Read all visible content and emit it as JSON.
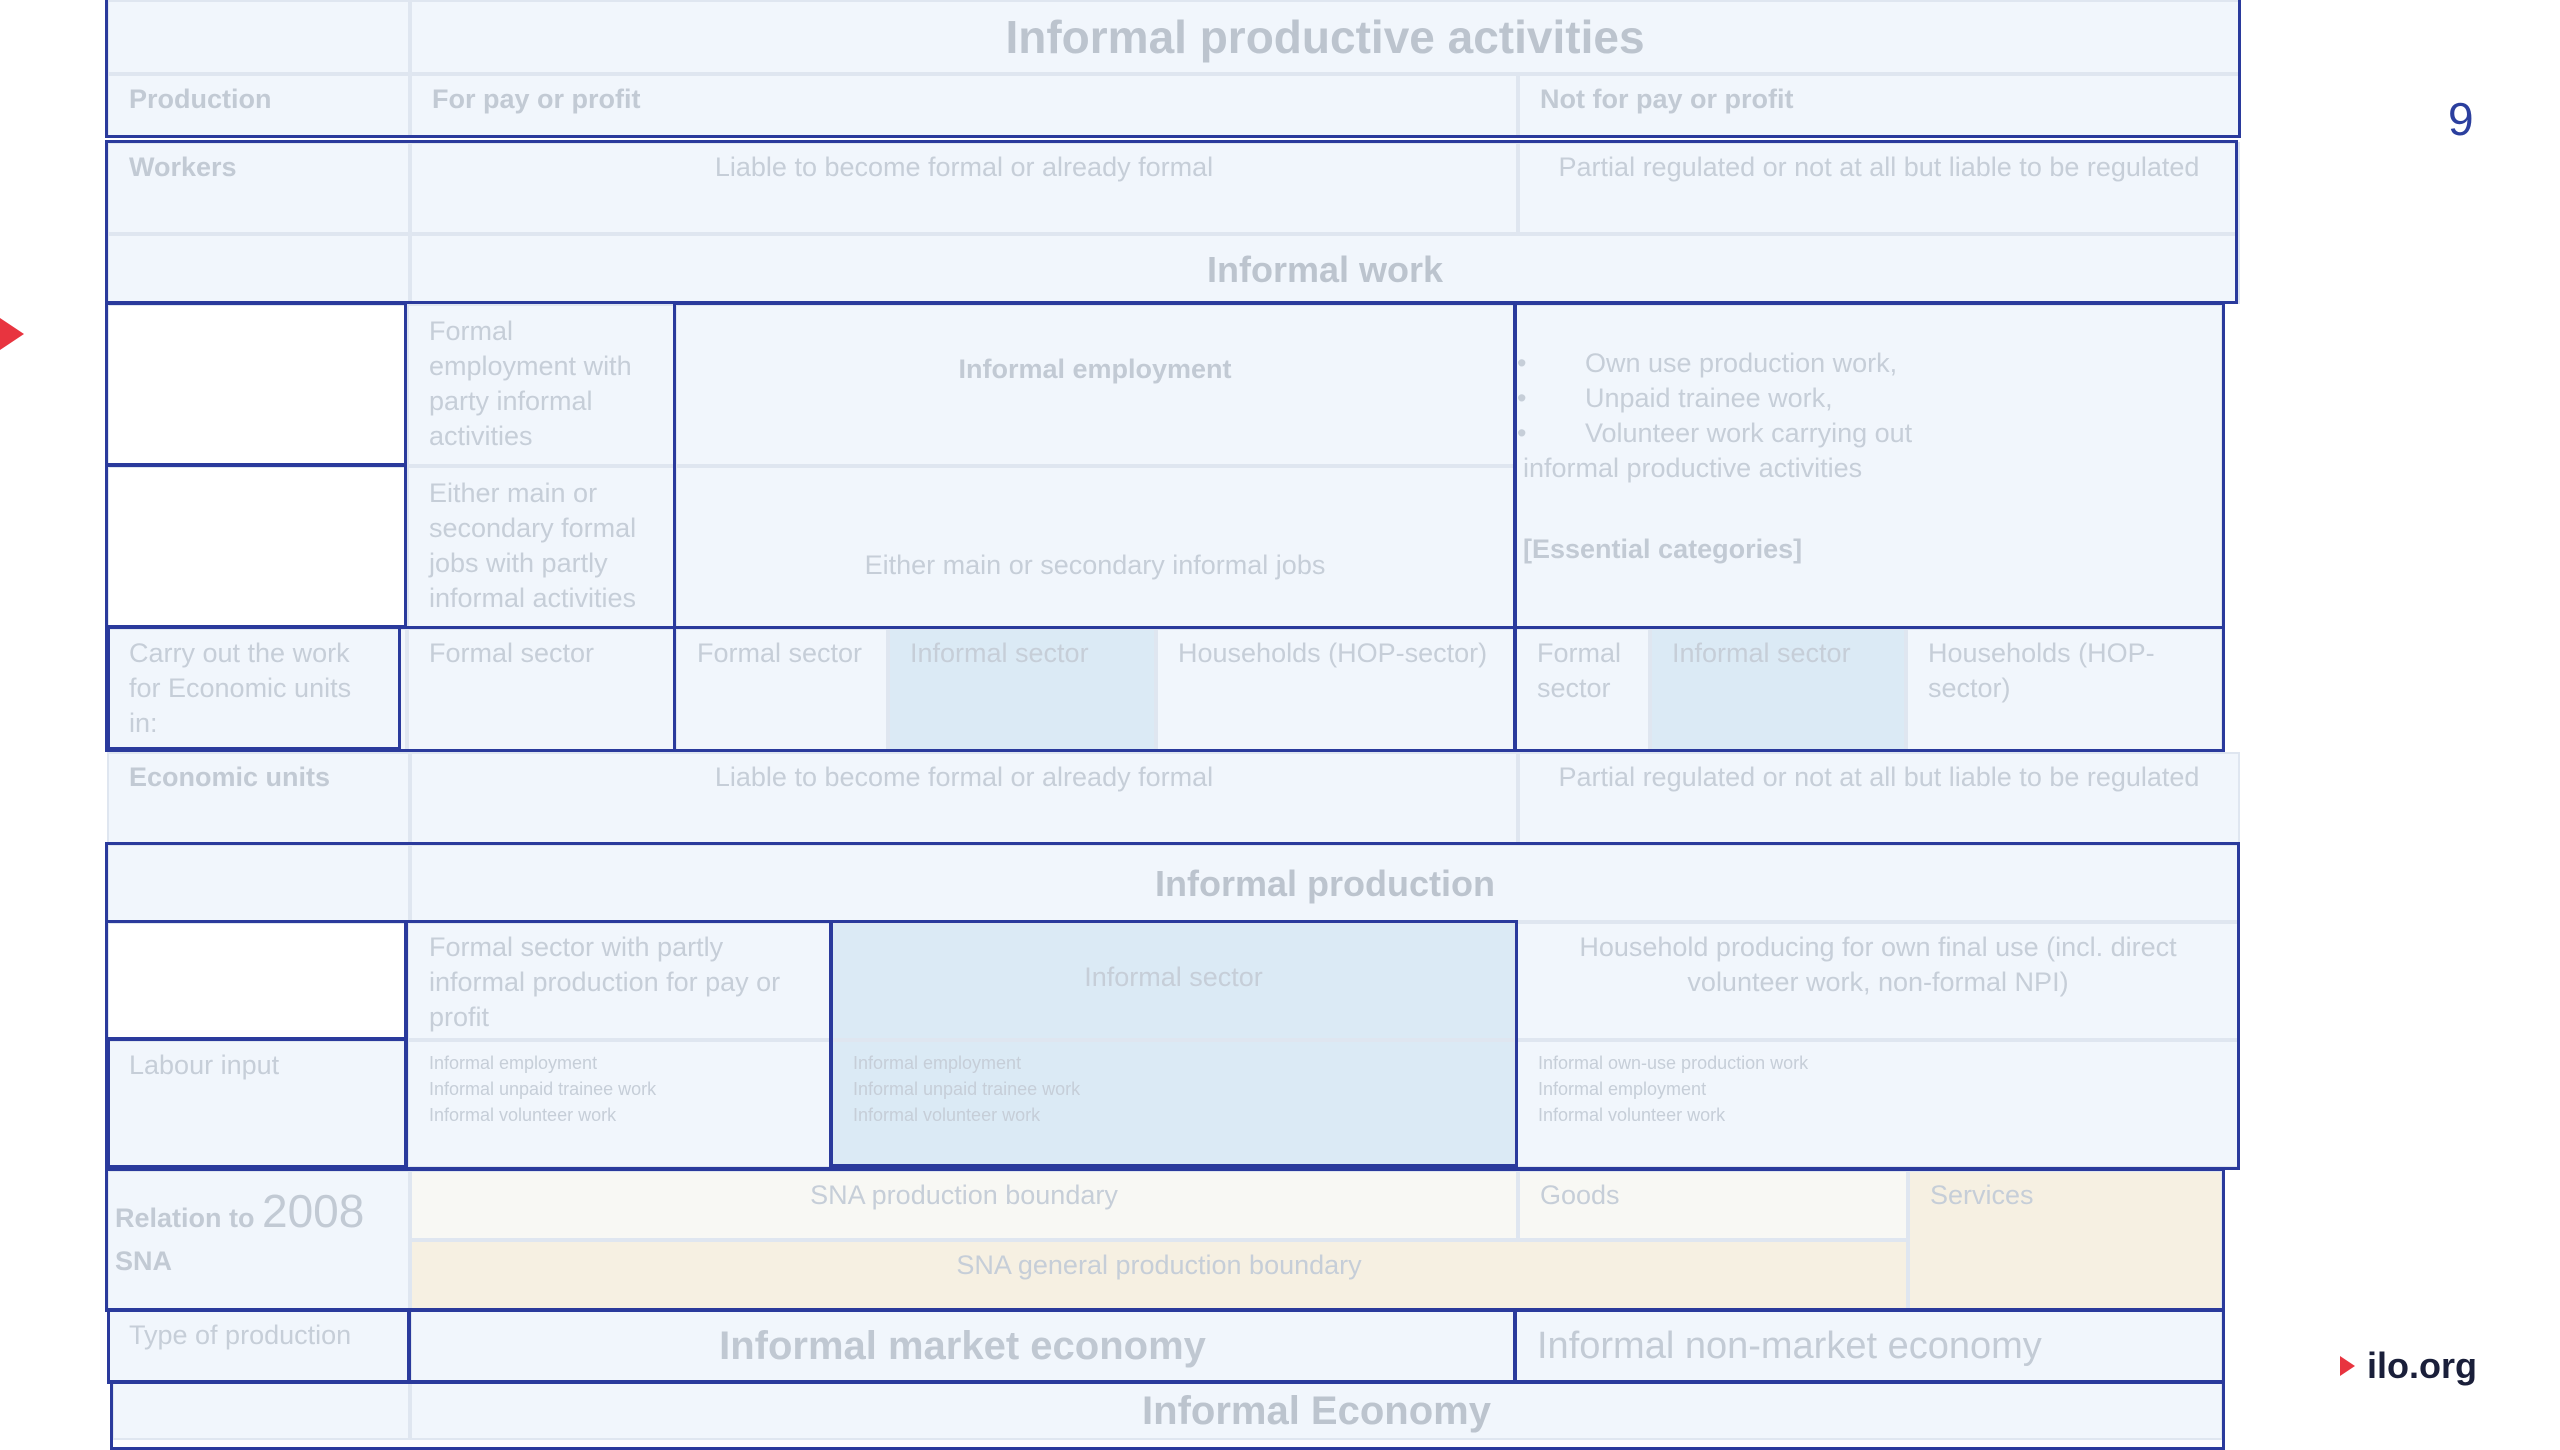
{
  "page_number": "9",
  "footer": {
    "brand": "ilo.org"
  },
  "title": "Informal productive activities",
  "header_row": {
    "label": "Production",
    "pay": "For pay or profit",
    "not_pay": "Not for pay or profit"
  },
  "workers_row": {
    "label": "Workers",
    "pay": "Liable to become formal or already formal",
    "not_pay": "Partial regulated or not at all but liable to be regulated"
  },
  "informal_work": "Informal work",
  "employment": {
    "formal_partly": "Formal employment with party informal activities",
    "formal_jobs": "Either main or secondary formal jobs with partly informal activities",
    "informal_employment": "Informal employment",
    "informal_jobs": "Either main or secondary informal jobs",
    "not_pay_items": [
      "Own use production work,",
      "Unpaid trainee work,",
      "Volunteer work carrying out"
    ],
    "not_pay_tail": "informal productive  activities",
    "essential": "[Essential categories]"
  },
  "units_row": {
    "label": "Carry out the work for Economic units in:",
    "formal_sector": "Formal sector",
    "formal_sector_2": "Formal sector",
    "informal_sector": "Informal sector",
    "households": "Households (HOP-sector)",
    "formal_sector_3": "Formal sector",
    "informal_sector_2": "Informal sector",
    "households_2": "Households (HOP-sector)"
  },
  "economic_units_row": {
    "label": "Economic units",
    "pay": "Liable to become formal or already formal",
    "not_pay": "Partial regulated or not at all but liable to be regulated"
  },
  "informal_production": "Informal production",
  "production": {
    "formal_partly": "Formal sector with partly informal production for pay or profit",
    "informal_sector": "Informal sector",
    "household": "Household producing for own final use (incl. direct volunteer work, non-formal NPI)"
  },
  "labour": {
    "label": "Labour input",
    "col1": [
      "Informal employment",
      "Informal unpaid trainee work",
      "Informal volunteer work"
    ],
    "col2": [
      "Informal employment",
      "Informal unpaid trainee work",
      "Informal volunteer work"
    ],
    "col3": [
      "Informal own-use production work",
      "Informal employment",
      "Informal volunteer work"
    ]
  },
  "sna": {
    "label_prefix": "Relation to ",
    "year": "2008",
    "label_suffix": "SNA",
    "production_boundary": "SNA production boundary",
    "goods": "Goods",
    "services": "Services",
    "general_boundary": "SNA general production boundary"
  },
  "type_row": {
    "label": "Type of production",
    "market": "Informal market economy",
    "non_market": "Informal non-market economy"
  },
  "informal_economy": "Informal Economy",
  "colors": {
    "frame": "#2a3a9c",
    "cell": "#f1f6fc",
    "informal_sector": "#dbeaf5",
    "services": "#f6f0e2",
    "accent": "#e8343f"
  }
}
